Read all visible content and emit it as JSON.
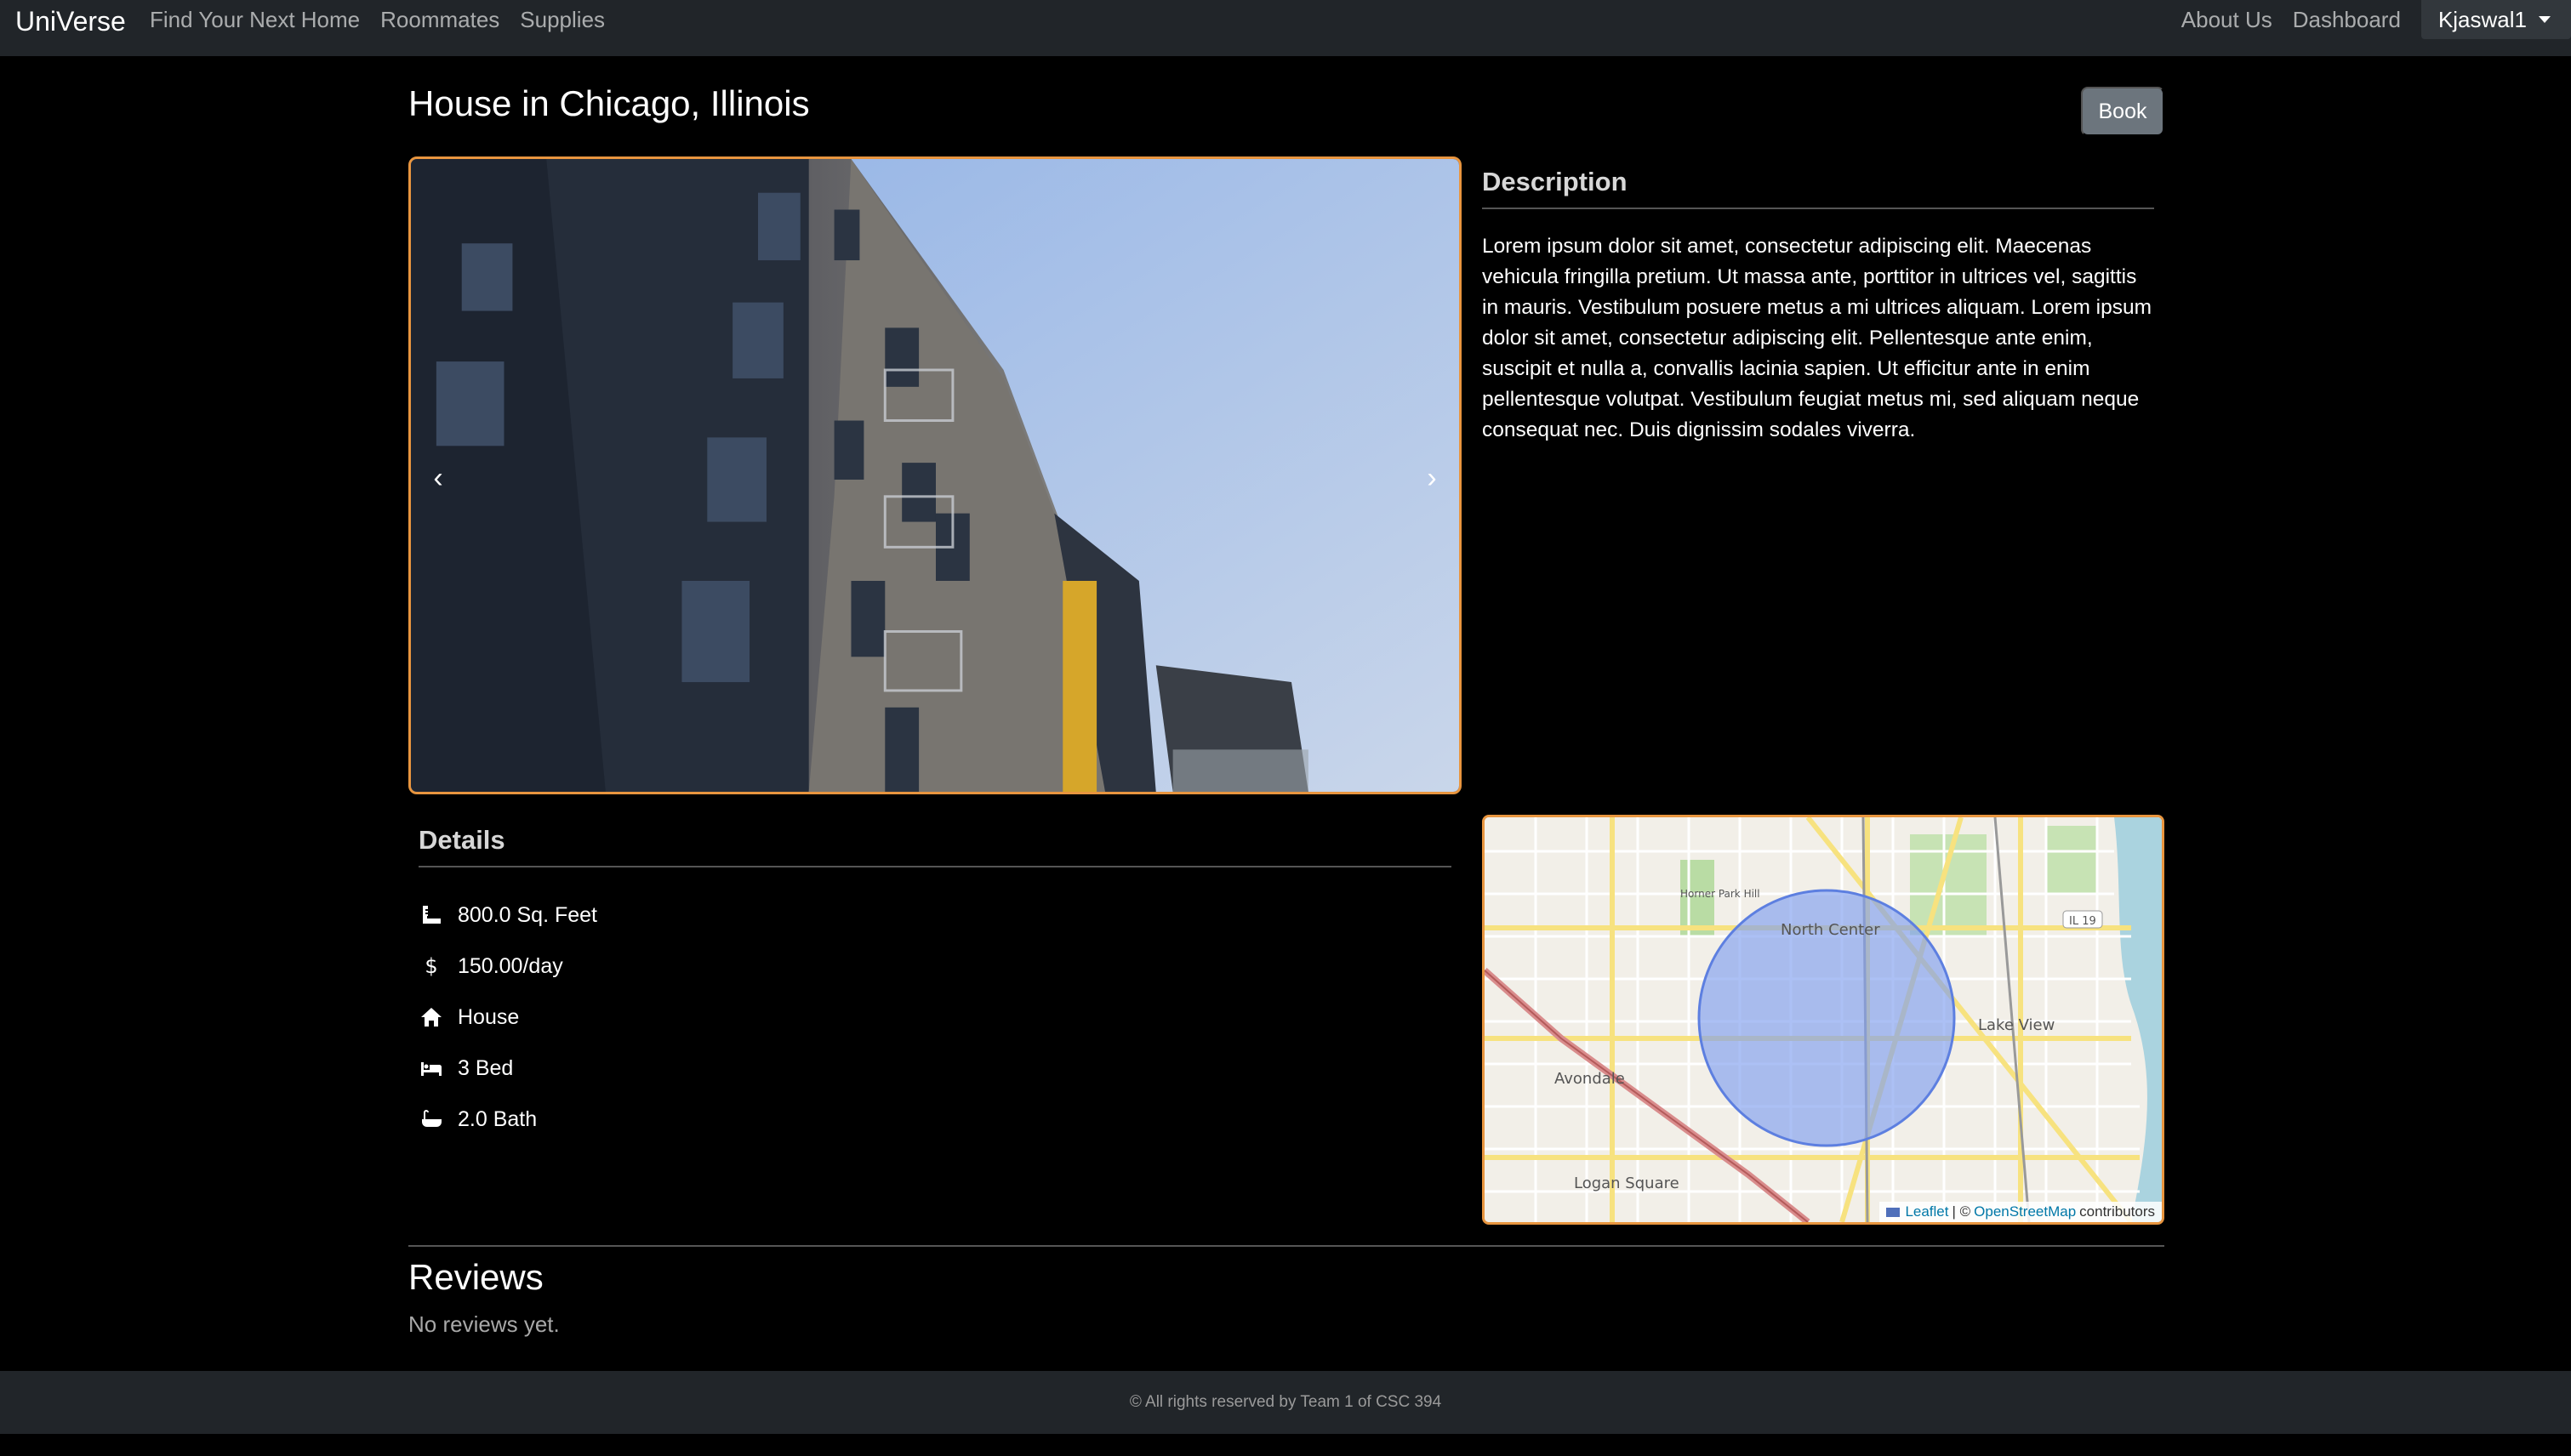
{
  "nav": {
    "brand": "UniVerse",
    "left_links": [
      "Find Your Next Home",
      "Roommates",
      "Supplies"
    ],
    "right_links": [
      "About Us",
      "Dashboard"
    ],
    "user": "Kjaswal1"
  },
  "listing": {
    "title": "House in Chicago, Illinois",
    "book_label": "Book",
    "carousel": {
      "prev": "‹",
      "next": "›"
    }
  },
  "description": {
    "heading": "Description",
    "text": "Lorem ipsum dolor sit amet, consectetur adipiscing elit. Maecenas vehicula fringilla pretium. Ut massa ante, porttitor in ultrices vel, sagittis in mauris. Vestibulum posuere metus a mi ultrices aliquam. Lorem ipsum dolor sit amet, consectetur adipiscing elit. Pellentesque ante enim, suscipit et nulla a, convallis lacinia sapien. Ut efficitur ante in enim pellentesque volutpat. Vestibulum feugiat metus mi, sed aliquam neque consequat nec. Duis dignissim sodales viverra."
  },
  "details": {
    "heading": "Details",
    "items": [
      {
        "icon": "ruler-icon",
        "text": "800.0 Sq. Feet"
      },
      {
        "icon": "dollar-icon",
        "text": "150.00/day"
      },
      {
        "icon": "house-icon",
        "text": "House"
      },
      {
        "icon": "bed-icon",
        "text": "3 Bed"
      },
      {
        "icon": "bath-icon",
        "text": "2.0 Bath"
      }
    ]
  },
  "map": {
    "labels": {
      "north_center": "North Center",
      "lake_view": "Lake View",
      "avondale": "Avondale",
      "logan_square": "Logan Square",
      "horner_park": "Horner Park Hill",
      "route_19": "IL 19"
    },
    "attribution": {
      "leaflet": "Leaflet",
      "sep": "| ©",
      "osm": "OpenStreetMap",
      "contrib": "contributors"
    }
  },
  "reviews": {
    "heading": "Reviews",
    "empty_text": "No reviews yet."
  },
  "footer": {
    "text": "© All rights reserved by Team 1 of CSC 394"
  },
  "colors": {
    "accent_border": "#e8953f",
    "navbar_bg": "#212529",
    "button_bg": "#6c757d"
  }
}
